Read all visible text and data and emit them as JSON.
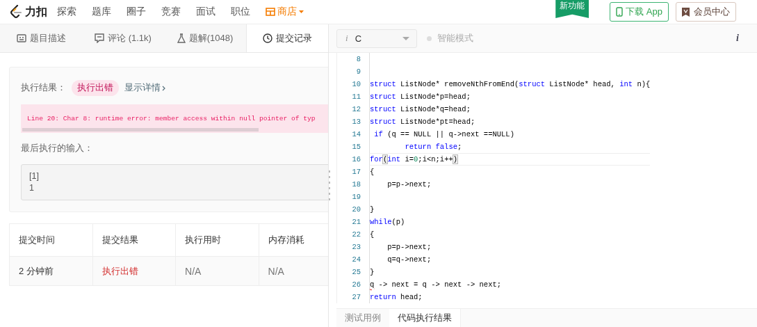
{
  "nav": {
    "logo_text": "力扣",
    "items": [
      {
        "label": "探索"
      },
      {
        "label": "题库"
      },
      {
        "label": "圈子"
      },
      {
        "label": "竞赛"
      },
      {
        "label": "面试"
      },
      {
        "label": "职位"
      }
    ],
    "shop": "商店",
    "new_badge": "新功能",
    "download_button": "下载 App",
    "vip_button": "会员中心"
  },
  "tabs": [
    {
      "label": "题目描述",
      "selected": false
    },
    {
      "label": "评论 (1.1k)",
      "selected": false
    },
    {
      "label": "题解(1048)",
      "selected": false
    },
    {
      "label": "提交记录",
      "selected": true
    }
  ],
  "result": {
    "label": "执行结果：",
    "status": "执行出错",
    "details_link": "显示详情",
    "error_message": "Line 20: Char 8: runtime error: member access within null pointer of typ",
    "last_input_label": "最后执行的输入：",
    "last_input": [
      "[1]",
      "1"
    ]
  },
  "table": {
    "columns": [
      "提交时间",
      "提交结果",
      "执行用时",
      "内存消耗"
    ],
    "rows": [
      {
        "time": "2 分钟前",
        "result": "执行出错",
        "runtime": "N/A",
        "memory": "N/A"
      }
    ]
  },
  "editor": {
    "lang_glyph": "i",
    "language": "C",
    "smart_mode": "智能模式",
    "info_glyph": "i",
    "lines": [
      {
        "number": "8"
      },
      {
        "number": "9"
      },
      {
        "number": "10",
        "segments": [
          {
            "text": "struct",
            "kind": "keyword"
          },
          {
            "text": " ListNode* removeNthFromEnd(",
            "kind": "plain"
          },
          {
            "text": "struct",
            "kind": "keyword"
          },
          {
            "text": " ListNode* head, ",
            "kind": "plain"
          },
          {
            "text": "int",
            "kind": "keyword"
          },
          {
            "text": " n){",
            "kind": "plain"
          }
        ]
      },
      {
        "number": "11",
        "segments": [
          {
            "text": "struct",
            "kind": "keyword"
          },
          {
            "text": " ListNode*p=head;",
            "kind": "plain"
          }
        ]
      },
      {
        "number": "12",
        "segments": [
          {
            "text": "struct",
            "kind": "keyword"
          },
          {
            "text": " ListNode*q=head;",
            "kind": "plain"
          }
        ]
      },
      {
        "number": "13",
        "segments": [
          {
            "text": "struct",
            "kind": "keyword"
          },
          {
            "text": " ListNode*pt=head;",
            "kind": "plain"
          }
        ]
      },
      {
        "number": "14",
        "segments": [
          {
            "text": " if",
            "kind": "keyword"
          },
          {
            "text": " (q == NULL || q->next ==NULL)",
            "kind": "plain"
          }
        ]
      },
      {
        "number": "15",
        "segments": [
          {
            "text": "        return",
            "kind": "keyword"
          },
          {
            "text": " false",
            "kind": "keyword"
          },
          {
            "text": ";",
            "kind": "plain"
          }
        ]
      },
      {
        "number": "16",
        "segments": [
          {
            "text": "for",
            "kind": "keyword"
          },
          {
            "text": "(",
            "kind": "bracket"
          },
          {
            "text": "int",
            "kind": "keyword"
          },
          {
            "text": " i=",
            "kind": "plain"
          },
          {
            "text": "0",
            "kind": "number"
          },
          {
            "text": ";i<n;i++",
            "kind": "plain"
          },
          {
            "text": ")",
            "kind": "bracket"
          }
        ]
      },
      {
        "number": "17",
        "segments": [
          {
            "text": "{",
            "kind": "plain"
          }
        ]
      },
      {
        "number": "18",
        "segments": [
          {
            "text": "    p=p->next;",
            "kind": "plain"
          }
        ]
      },
      {
        "number": "19"
      },
      {
        "number": "20",
        "segments": [
          {
            "text": "}",
            "kind": "plain"
          }
        ]
      },
      {
        "number": "21",
        "segments": [
          {
            "text": "while",
            "kind": "keyword"
          },
          {
            "text": "(p)",
            "kind": "plain"
          }
        ]
      },
      {
        "number": "22",
        "segments": [
          {
            "text": "{",
            "kind": "plain"
          }
        ]
      },
      {
        "number": "23",
        "segments": [
          {
            "text": "    p=p->next;",
            "kind": "plain"
          }
        ]
      },
      {
        "number": "24",
        "segments": [
          {
            "text": "    q=q->next;",
            "kind": "plain"
          }
        ]
      },
      {
        "number": "25",
        "segments": [
          {
            "text": "}",
            "kind": "plain"
          }
        ]
      },
      {
        "number": "26",
        "segments": [
          {
            "text": "q",
            "kind": "error"
          },
          {
            "text": " -> next = q -> next -> next;",
            "kind": "plain"
          }
        ]
      },
      {
        "number": "27",
        "segments": [
          {
            "text": "return",
            "kind": "keyword"
          },
          {
            "text": " head;",
            "kind": "plain"
          }
        ]
      }
    ],
    "bottom_tabs": [
      {
        "label": "测试用例",
        "selected": false
      },
      {
        "label": "代码执行结果",
        "selected": true
      }
    ]
  }
}
